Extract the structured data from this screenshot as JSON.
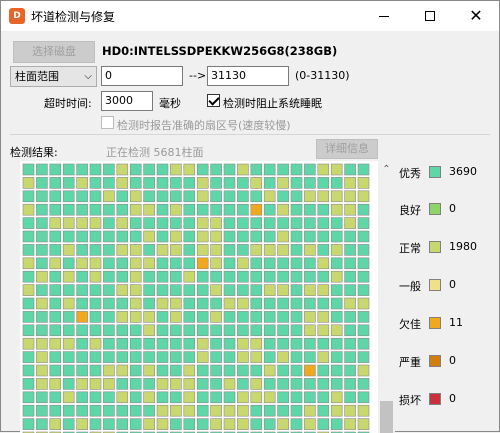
{
  "window": {
    "title": "坏道检测与修复",
    "app_icon_text": "D"
  },
  "controls": {
    "select_disk_label": "选择磁盘",
    "disk_name": "HD0:INTELSSDPEKKW256G8(238GB)",
    "range_mode": "柱面范围",
    "start_value": "0",
    "arrow": "-->",
    "end_value": "31130",
    "range_hint": "(0-31130)",
    "timeout_label": "超时时间:",
    "timeout_value": "3000",
    "timeout_unit": "毫秒",
    "stop_on_timeout_label": "检测时阻止系统睡眠",
    "stop_on_timeout_checked": true,
    "report_label": "检测时报告准确的扇区号(速度较慢)",
    "report_checked": false
  },
  "results": {
    "label": "检测结果:",
    "status": "正在检测 5681柱面",
    "detail_button": "详细信息"
  },
  "legend": [
    {
      "name": "优秀",
      "color": "#5ed6a8",
      "count": "3690"
    },
    {
      "name": "良好",
      "color": "#8fd46a",
      "count": "0"
    },
    {
      "name": "正常",
      "color": "#c9d86e",
      "count": "1980"
    },
    {
      "name": "一般",
      "color": "#efe08a",
      "count": "0"
    },
    {
      "name": "欠佳",
      "color": "#f0a81e",
      "count": "11"
    },
    {
      "name": "严重",
      "color": "#d27d10",
      "count": "0"
    },
    {
      "name": "损坏",
      "color": "#c8303c",
      "count": "0"
    }
  ],
  "icons": {
    "minimize": "minimize-icon",
    "maximize": "maximize-icon",
    "close": "close-icon",
    "scroll_up": "chevron-up-icon",
    "dropdown": "chevron-down-icon"
  }
}
